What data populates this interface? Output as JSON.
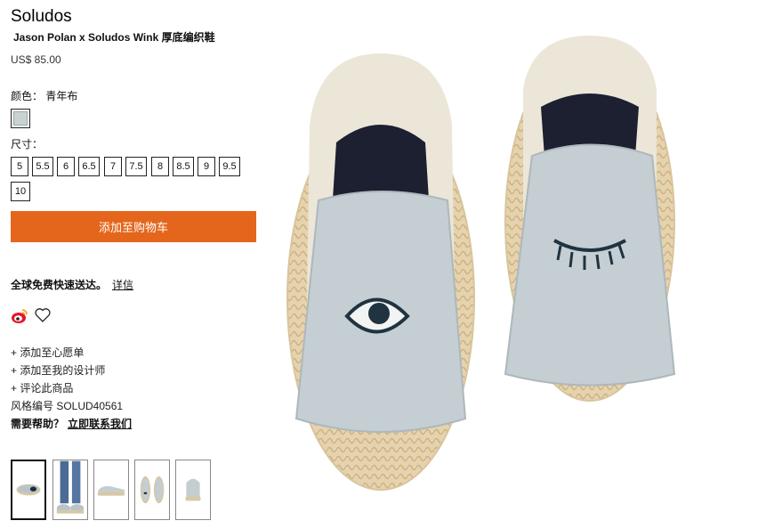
{
  "product": {
    "brand": "Soludos",
    "name": "Jason Polan x Soludos Wink 厚底编织鞋",
    "price": "US$ 85.00"
  },
  "color": {
    "label": "颜色：",
    "value": "青年布",
    "swatch_color": "#c9d1d3"
  },
  "sizes": {
    "label": "尺寸：",
    "options": [
      "5",
      "5.5",
      "6",
      "6.5",
      "7",
      "7.5",
      "8",
      "8.5",
      "9",
      "9.5",
      "10"
    ]
  },
  "cart": {
    "label": "添加至购物车",
    "color": "#e4661c"
  },
  "shipping": {
    "text": "全球免费快速送达。",
    "link": "详信"
  },
  "social": {
    "share_icon": "weibo-icon",
    "fav_icon": "heart-icon"
  },
  "actions": {
    "wishlist": "+ 添加至心愿单",
    "designer": "+ 添加至我的设计师",
    "review": "+ 评论此商品"
  },
  "style_number": "风格编号 SOLUD40561",
  "help": {
    "text": "需要帮助？",
    "link": "立即联系我们"
  },
  "thumbnails": [
    "shoe-top-view",
    "model-wearing",
    "shoe-side-view",
    "shoe-pair-view",
    "shoe-back-view"
  ]
}
